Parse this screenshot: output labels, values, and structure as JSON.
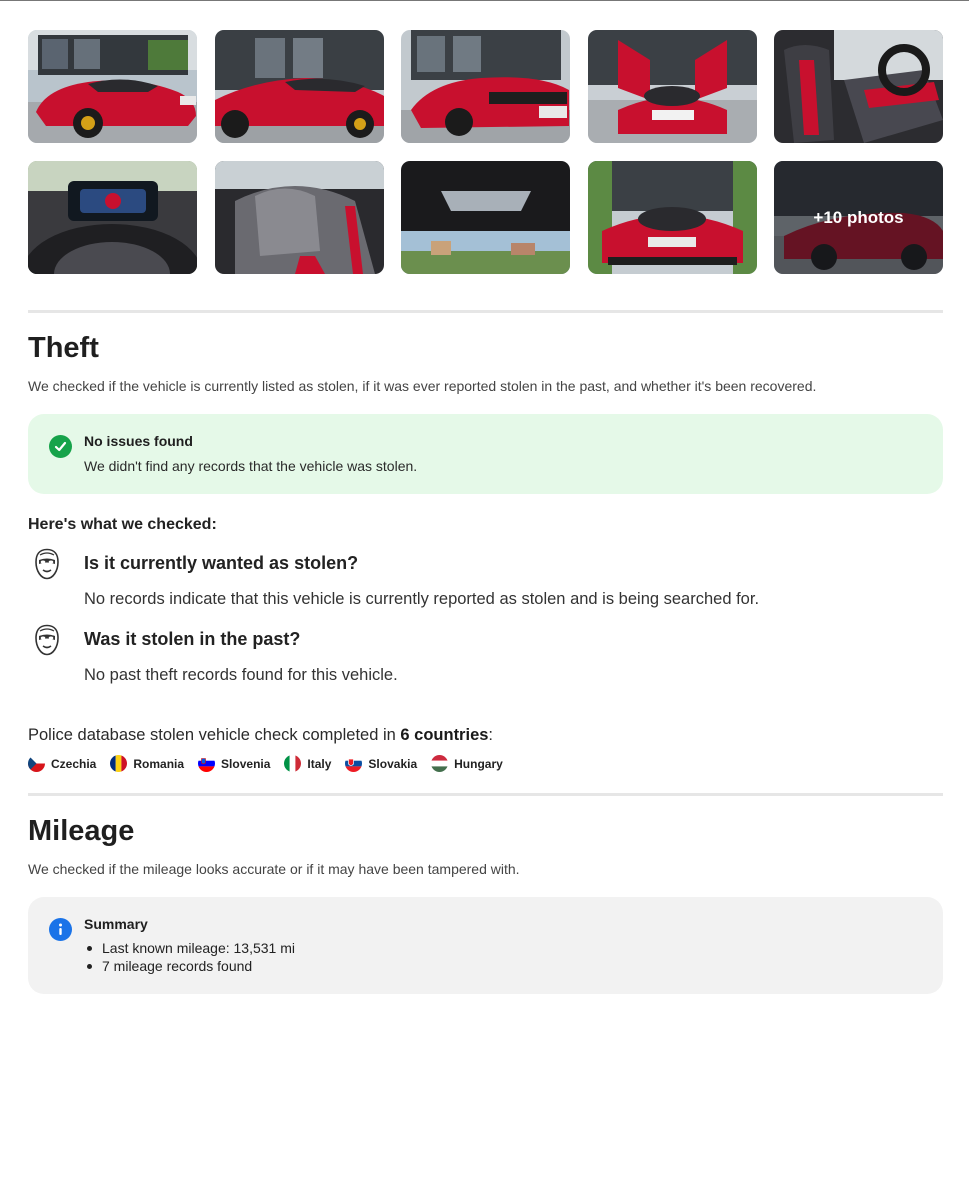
{
  "gallery": {
    "photos": [
      {
        "alt": "front-side-view"
      },
      {
        "alt": "side-view"
      },
      {
        "alt": "rear-side-view"
      },
      {
        "alt": "front-doors-open"
      },
      {
        "alt": "interior-seats"
      },
      {
        "alt": "instrument-cluster"
      },
      {
        "alt": "seat-detail"
      },
      {
        "alt": "glass-roof"
      },
      {
        "alt": "front-view"
      },
      {
        "alt": "more-photos"
      }
    ],
    "more_label": "+10 photos"
  },
  "theft": {
    "title": "Theft",
    "description": "We checked if the vehicle is currently listed as stolen, if it was ever reported stolen in the past, and whether it's been recovered.",
    "status": {
      "title": "No issues found",
      "text": "We didn't find any records that the vehicle was stolen.",
      "color": "#16a34a"
    },
    "checked_heading": "Here's what we checked:",
    "checks": [
      {
        "question": "Is it currently wanted as stolen?",
        "answer": "No records indicate that this vehicle is currently reported as stolen and is being searched for.",
        "icon": "thief-mask-icon"
      },
      {
        "question": "Was it stolen in the past?",
        "answer": "No past theft records found for this vehicle.",
        "icon": "thief-mask-icon"
      }
    ],
    "police": {
      "prefix": "Police database stolen vehicle check completed in ",
      "count": "6 countries",
      "suffix": ":"
    },
    "countries": [
      {
        "name": "Czechia",
        "flag": "czechia-flag-icon"
      },
      {
        "name": "Romania",
        "flag": "romania-flag-icon"
      },
      {
        "name": "Slovenia",
        "flag": "slovenia-flag-icon"
      },
      {
        "name": "Italy",
        "flag": "italy-flag-icon"
      },
      {
        "name": "Slovakia",
        "flag": "slovakia-flag-icon"
      },
      {
        "name": "Hungary",
        "flag": "hungary-flag-icon"
      }
    ]
  },
  "mileage": {
    "title": "Mileage",
    "description": "We checked if the mileage looks accurate or if it may have been tampered with.",
    "summary": {
      "title": "Summary",
      "items": [
        "Last known mileage: 13,531 mi",
        "7 mileage records found"
      ],
      "color": "#1a73e8"
    }
  },
  "colors": {
    "car_red": "#c8102e",
    "success_bg": "#e5f9e8",
    "info_bg": "#f2f2f2"
  }
}
